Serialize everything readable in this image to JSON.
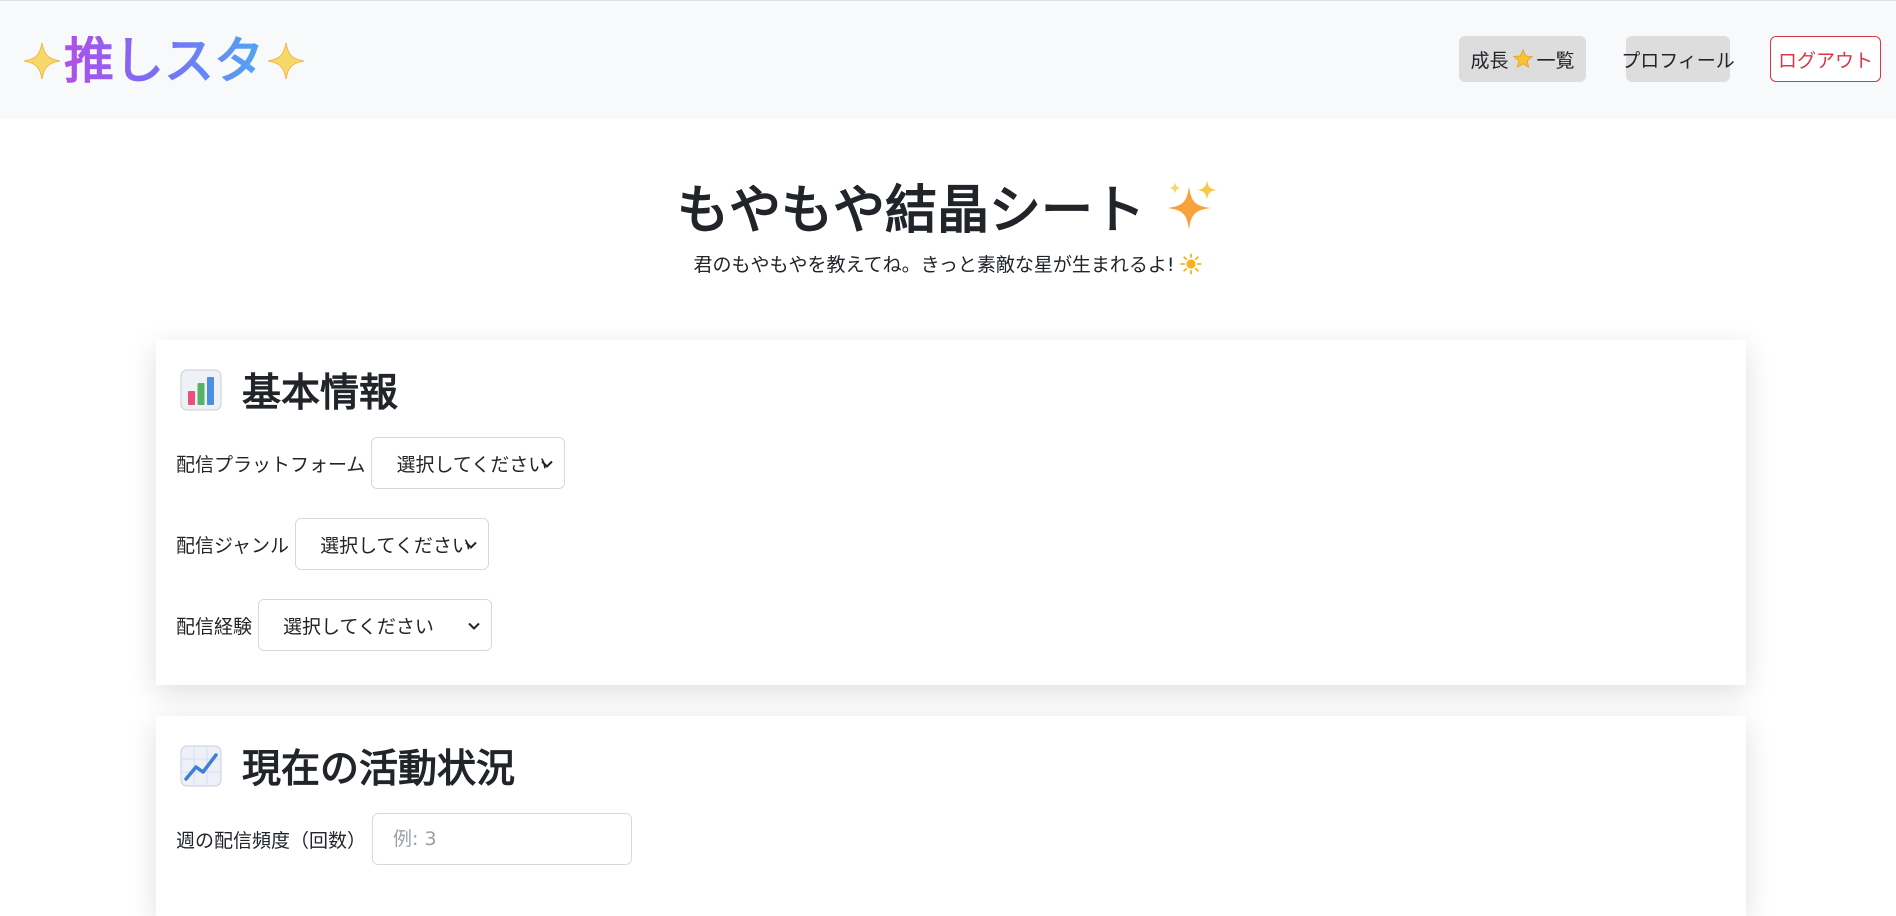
{
  "header": {
    "brand": "推しスタ",
    "nav": {
      "growth_prefix": "成長",
      "growth_suffix": "一覧",
      "growth_icon": "star-icon",
      "profile": "プロフィール",
      "logout": "ログアウト"
    },
    "colors": {
      "logout": "#dc3545",
      "nav_button_bg": "#dddddd",
      "navbar_bg": "#f8f9fa"
    }
  },
  "page": {
    "title": "もやもや結晶シート",
    "title_icon": "sparkles-icon",
    "subtitle": "君のもやもやを教えてね。きっと素敵な星が生まれるよ!",
    "subtitle_icon": "sun-icon"
  },
  "sections": {
    "basic": {
      "title": "基本情報",
      "icon": "bar-chart-icon",
      "fields": {
        "platform": {
          "label": "配信プラットフォーム",
          "value": "選択してください"
        },
        "genre": {
          "label": "配信ジャンル",
          "value": "選択してください"
        },
        "experience": {
          "label": "配信経験",
          "value": "選択してください"
        }
      }
    },
    "activity": {
      "title": "現在の活動状況",
      "icon": "line-chart-icon",
      "fields": {
        "frequency": {
          "label": "週の配信頻度（回数）",
          "placeholder": "例: 3",
          "value": ""
        }
      }
    }
  }
}
